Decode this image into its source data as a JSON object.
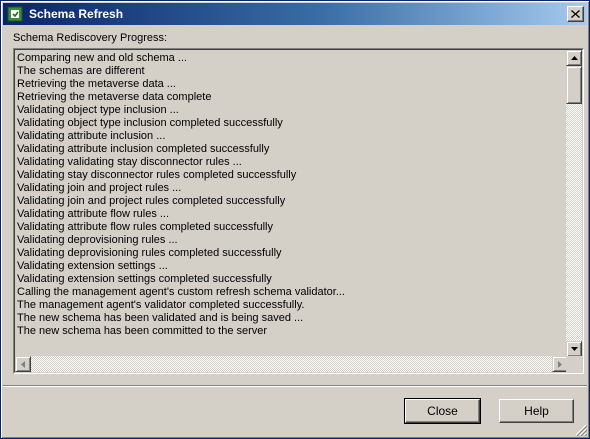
{
  "window": {
    "title": "Schema Refresh",
    "close_glyph": "✕"
  },
  "main": {
    "progress_label": "Schema Rediscovery Progress:",
    "log_lines": [
      "Comparing new and old schema ...",
      "The schemas are different",
      "Retrieving the metaverse data ...",
      "Retrieving the metaverse data complete",
      "Validating object type inclusion ...",
      "Validating object type inclusion completed successfully",
      "Validating attribute inclusion ...",
      "Validating attribute inclusion completed successfully",
      "Validating validating stay disconnector rules ...",
      "Validating stay disconnector rules completed successfully",
      "Validating join and project rules ...",
      "Validating join and project rules completed successfully",
      "Validating attribute flow rules ...",
      "Validating attribute flow rules completed successfully",
      "Validating deprovisioning rules ...",
      "Validating deprovisioning rules completed successfully",
      "Validating extension settings ...",
      "Validating extension settings completed successfully",
      "Calling the management agent's custom refresh schema validator...",
      "The management agent's validator completed successfully.",
      "The new schema has been validated and is being saved ...",
      "The new schema has been committed to the server"
    ]
  },
  "footer": {
    "close_label": "Close",
    "help_label": "Help"
  },
  "icons": {
    "app_icon": "schema-refresh-icon",
    "close_icon": "close-icon",
    "up_arrow": "arrow-up-icon",
    "down_arrow": "arrow-down-icon",
    "left_arrow": "arrow-left-icon",
    "right_arrow": "arrow-right-icon",
    "grip": "resize-grip-icon"
  },
  "colors": {
    "titlebar_start": "#0a246a",
    "titlebar_end": "#a6caf0",
    "face": "#d4d0c8"
  }
}
